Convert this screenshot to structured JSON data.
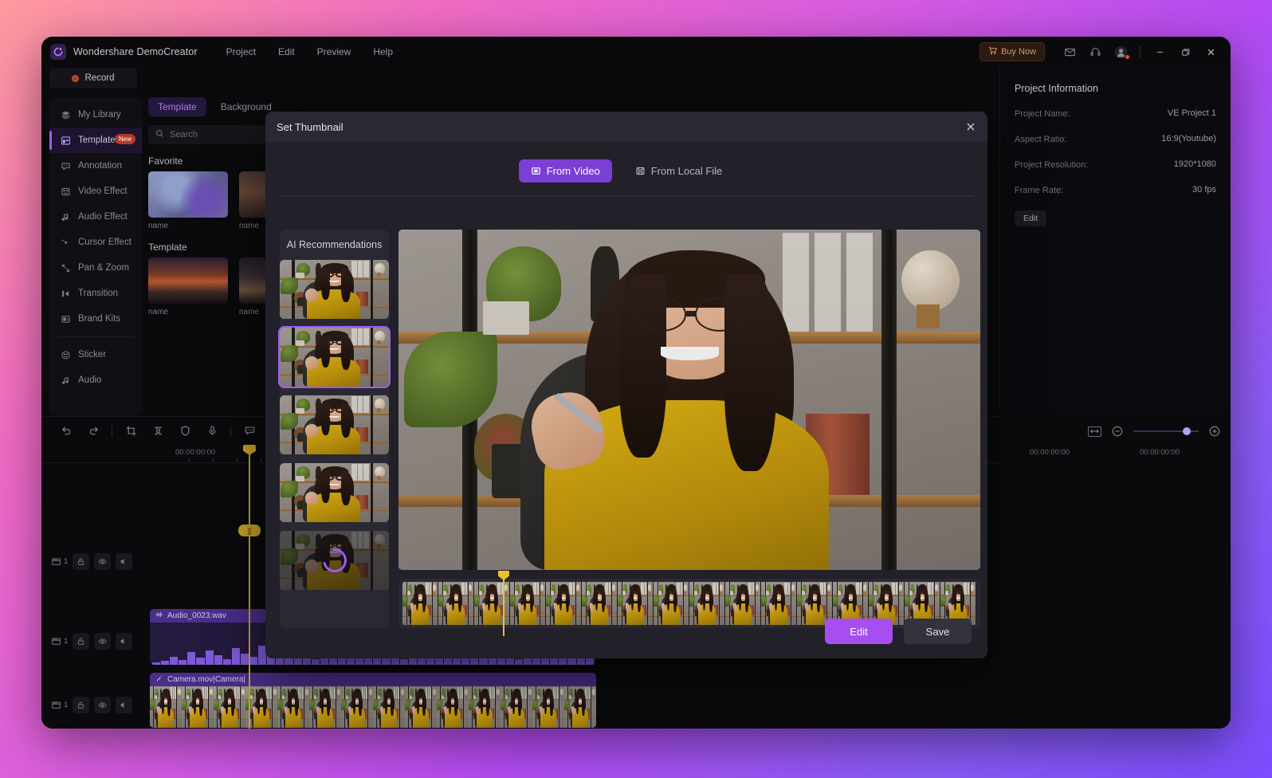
{
  "app": {
    "title": "Wondershare DemoCreator",
    "logo_icon": "democreator-logo-icon",
    "menu": [
      "Project",
      "Edit",
      "Preview",
      "Help"
    ],
    "record_label": "Record",
    "titlebar_right": {
      "buy_now": "Buy Now",
      "cart_icon": "cart-icon",
      "mail_icon": "mail-icon",
      "headset_icon": "headset-support-icon",
      "account_icon": "account-avatar-icon",
      "minimize_icon": "minimize-icon",
      "maximize_icon": "maximize-restore-icon",
      "close_icon": "close-icon"
    }
  },
  "sidebar": {
    "items": [
      {
        "label": "My Library",
        "icon": "layers-icon",
        "active": false,
        "badge": ""
      },
      {
        "label": "Template",
        "icon": "template-grid-icon",
        "active": true,
        "badge": "New"
      },
      {
        "label": "Annotation",
        "icon": "annotation-bubble-icon",
        "active": false,
        "badge": ""
      },
      {
        "label": "Video Effect",
        "icon": "video-effect-icon",
        "active": false,
        "badge": ""
      },
      {
        "label": "Audio Effect",
        "icon": "audio-note-icon",
        "active": false,
        "badge": ""
      },
      {
        "label": "Cursor Effect",
        "icon": "cursor-sparkle-icon",
        "active": false,
        "badge": ""
      },
      {
        "label": "Pan & Zoom",
        "icon": "pan-zoom-arrows-icon",
        "active": false,
        "badge": ""
      },
      {
        "label": "Transition",
        "icon": "transition-icon",
        "active": false,
        "badge": ""
      },
      {
        "label": "Brand Kits",
        "icon": "brand-kit-icon",
        "active": false,
        "badge": ""
      }
    ],
    "items2": [
      {
        "label": "Sticker",
        "icon": "sticker-smiley-icon"
      },
      {
        "label": "Audio",
        "icon": "music-note-icon"
      }
    ]
  },
  "template_panel": {
    "tabs": [
      {
        "label": "Template",
        "active": true
      },
      {
        "label": "Background",
        "active": false
      }
    ],
    "search_placeholder": "Search",
    "search_value": "",
    "search_icon": "search-icon",
    "sections": [
      {
        "title": "Favorite",
        "items": [
          {
            "name": "name"
          },
          {
            "name": "name"
          }
        ]
      },
      {
        "title": "Template",
        "items": [
          {
            "name": "name"
          },
          {
            "name": "name"
          }
        ]
      }
    ]
  },
  "project_info": {
    "title": "Project Information",
    "rows": [
      {
        "label": "Project Name:",
        "value": "VE Project 1"
      },
      {
        "label": "Aspect Ratio:",
        "value": "16:9(Youtube)"
      },
      {
        "label": "Project Resolution:",
        "value": "1920*1080"
      },
      {
        "label": "Frame Rate:",
        "value": "30 fps"
      }
    ],
    "edit_label": "Edit"
  },
  "timeline": {
    "toolbar": [
      {
        "icon": "undo-icon"
      },
      {
        "icon": "redo-icon"
      },
      {
        "icon": "crop-icon"
      },
      {
        "icon": "split-icon"
      },
      {
        "icon": "shield-icon"
      },
      {
        "icon": "microphone-icon"
      },
      {
        "icon": "caption-bubble-icon"
      }
    ],
    "ruler_left_time": "00:00:00:00",
    "ruler_left_time2": "00:",
    "ruler_right_time1": "00:00:00:00",
    "ruler_right_time2": "00:00:00:00",
    "playhead_label": "][",
    "zoom": {
      "fit_icon": "fit-to-screen-icon",
      "minus_icon": "zoom-out-icon",
      "plus_icon": "zoom-in-icon"
    },
    "tracks": [
      {
        "count": "1",
        "lock_icon": "unlock-icon",
        "eye_icon": "eye-icon",
        "mute_icon": "mute-speaker-icon",
        "clip": null
      },
      {
        "count": "1",
        "lock_icon": "unlock-icon",
        "eye_icon": "eye-icon",
        "mute_icon": "mute-speaker-icon",
        "clip": "Audio_0023.wav"
      },
      {
        "count": "1",
        "lock_icon": "unlock-icon",
        "eye_icon": "eye-icon",
        "mute_icon": "mute-speaker-icon",
        "clip": "Camera.mov|Camera|"
      }
    ]
  },
  "modal": {
    "title": "Set Thumbnail",
    "close_icon": "close-icon",
    "tabs": [
      {
        "label": "From Video",
        "icon": "video-frame-icon",
        "active": true
      },
      {
        "label": "From Local File",
        "icon": "local-file-icon",
        "active": false
      }
    ],
    "ai_panel": {
      "title": "AI Recommendations",
      "thumbs": [
        {
          "state": "normal"
        },
        {
          "state": "selected"
        },
        {
          "state": "normal"
        },
        {
          "state": "normal"
        },
        {
          "state": "loading"
        }
      ]
    },
    "buttons": {
      "edit": "Edit",
      "save": "Save"
    }
  },
  "colors": {
    "accent_purple": "#a259ff",
    "tab_active": "#7b3fd4",
    "edit_button": "#a64ef0",
    "playhead_yellow": "#c9a227",
    "strip_playhead": "#e8c22c",
    "badge_red": "#b2392a",
    "buy_now_text": "#d89a5c",
    "window_bg": "#0a0a0c",
    "modal_bg": "#222028",
    "modal_header_bg": "#2a2832"
  }
}
